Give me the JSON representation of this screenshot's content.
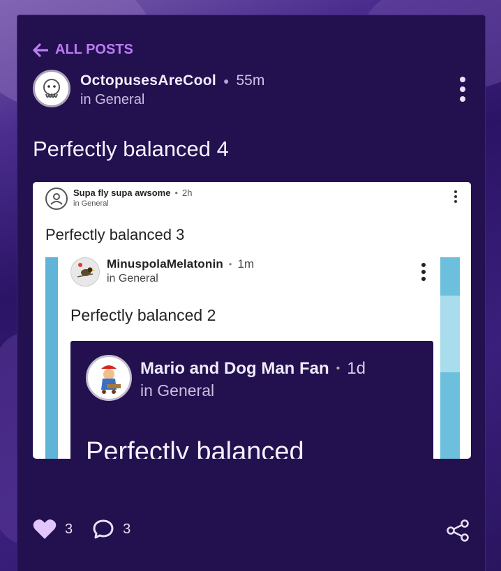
{
  "nav": {
    "back_label": "ALL POSTS"
  },
  "post": {
    "author": "OctopusesAreCool",
    "time": "55m",
    "category": "in General",
    "title": "Perfectly balanced 4",
    "likes": "3",
    "comments": "3"
  },
  "embedded": {
    "level1": {
      "author": "Supa fly supa awsome",
      "time": "2h",
      "category": "in General",
      "title": "Perfectly balanced 3"
    },
    "level2": {
      "author": "MinuspolaMelatonin",
      "time": "1m",
      "category": "in General",
      "title": "Perfectly balanced 2"
    },
    "level3": {
      "author": "Mario and Dog Man Fan",
      "time": "1d",
      "category": "in General",
      "title": "Perfectly balanced"
    }
  },
  "colors": {
    "accent": "#bd7cf5",
    "card_bg": "#22104f",
    "like": "#e2c6fb"
  },
  "icons": [
    "back-arrow-icon",
    "more-vertical-icon",
    "heart-icon",
    "comment-icon",
    "share-icon"
  ]
}
